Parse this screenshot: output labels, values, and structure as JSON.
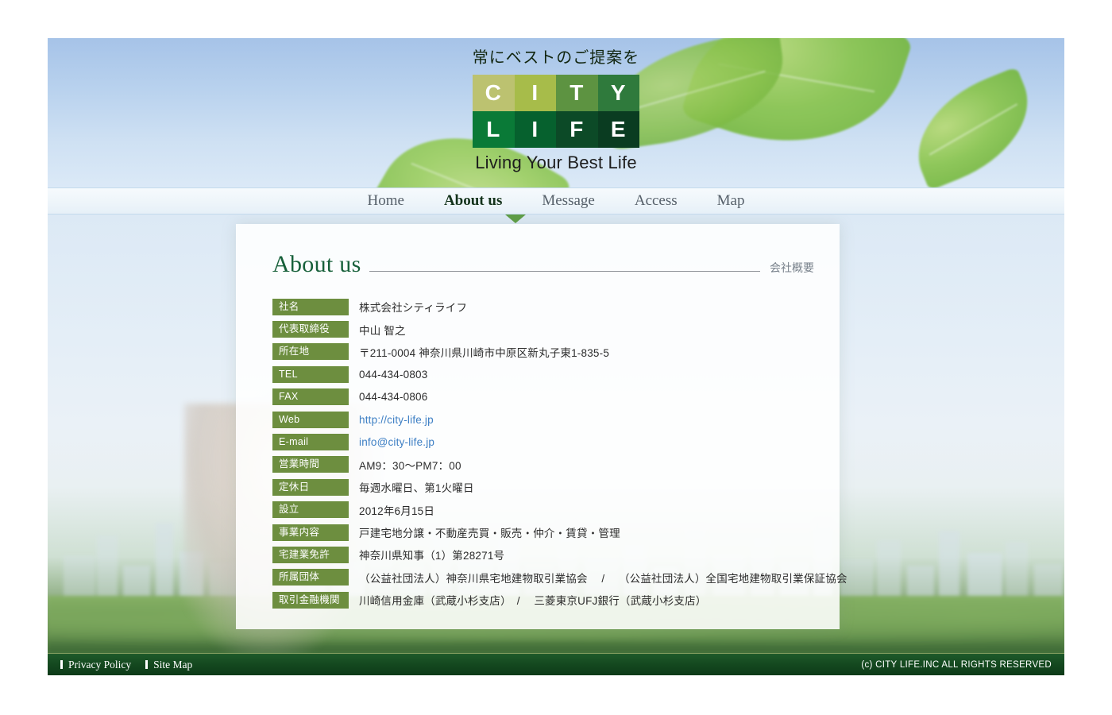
{
  "brand": {
    "tagline": "常にベストのご提案を",
    "logo_cells": [
      {
        "letter": "C",
        "color": "#bcc270"
      },
      {
        "letter": "I",
        "color": "#a7bc4a"
      },
      {
        "letter": "T",
        "color": "#5d9341"
      },
      {
        "letter": "Y",
        "color": "#2f7a3c"
      },
      {
        "letter": "L",
        "color": "#0a7a37"
      },
      {
        "letter": "I",
        "color": "#06612e"
      },
      {
        "letter": "F",
        "color": "#0c4a27"
      },
      {
        "letter": "E",
        "color": "#0a3c21"
      }
    ],
    "subtitle": "Living Your Best Life"
  },
  "nav": {
    "items": [
      {
        "label": "Home",
        "active": false
      },
      {
        "label": "About us",
        "active": true
      },
      {
        "label": "Message",
        "active": false
      },
      {
        "label": "Access",
        "active": false
      },
      {
        "label": "Map",
        "active": false
      }
    ]
  },
  "content": {
    "title": "About us",
    "title_ja": "会社概要",
    "rows": [
      {
        "label": "社名",
        "value": "株式会社シティライフ",
        "link": false
      },
      {
        "label": "代表取締役",
        "value": "中山 智之",
        "link": false
      },
      {
        "label": "所在地",
        "value": "〒211-0004 神奈川県川崎市中原区新丸子東1-835-5",
        "link": false
      },
      {
        "label": "TEL",
        "value": "044-434-0803",
        "link": false
      },
      {
        "label": "FAX",
        "value": "044-434-0806",
        "link": false
      },
      {
        "label": "Web",
        "value": "http://city-life.jp",
        "link": true
      },
      {
        "label": "E-mail",
        "value": "info@city-life.jp",
        "link": true
      },
      {
        "label": "営業時間",
        "value": "AM9：30〜PM7：00",
        "link": false
      },
      {
        "label": "定休日",
        "value": "毎週水曜日、第1火曜日",
        "link": false
      },
      {
        "label": "設立",
        "value": "2012年6月15日",
        "link": false
      },
      {
        "label": "事業内容",
        "value": "戸建宅地分譲・不動産売買・販売・仲介・賃貸・管理",
        "link": false
      },
      {
        "label": "宅建業免許",
        "value": "神奈川県知事（1）第28271号",
        "link": false
      },
      {
        "label": "所属団体",
        "value": "（公益社団法人）神奈川県宅地建物取引業協会　 /　 （公益社団法人）全国宅地建物取引業保証協会",
        "link": false
      },
      {
        "label": "取引金融機関",
        "value": "川崎信用金庫（武蔵小杉支店）　/　 三菱東京UFJ銀行（武蔵小杉支店）",
        "link": false
      }
    ]
  },
  "footer": {
    "links": [
      {
        "label": "Privacy Policy"
      },
      {
        "label": "Site Map"
      }
    ],
    "copyright": "(c)  CITY LIFE.INC ALL RIGHTS RESERVED"
  },
  "colors": {
    "accent_green": "#17603a",
    "label_green": "#6d8e3f",
    "link_blue": "#3d7fc4",
    "footer_green": "#14481f"
  }
}
